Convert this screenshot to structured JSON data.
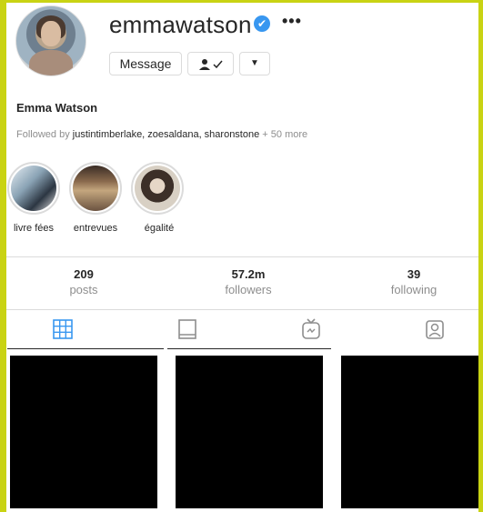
{
  "profile": {
    "username": "emmawatson",
    "verified_icon": "verified-badge-icon",
    "more_icon": "ellipsis-icon",
    "full_name": "Emma Watson",
    "followed_by_prefix": "Followed by",
    "followed_by_names": "justintimberlake, zoesaldana, sharonstone",
    "followed_by_more": "+ 50 more"
  },
  "actions": {
    "message_label": "Message",
    "following_icon": "person-check-icon",
    "dropdown_icon": "caret-down-icon"
  },
  "highlights": [
    {
      "label": "livre fées"
    },
    {
      "label": "entrevues"
    },
    {
      "label": "égalité"
    }
  ],
  "stats": [
    {
      "value": "209",
      "label": "posts"
    },
    {
      "value": "57.2m",
      "label": "followers"
    },
    {
      "value": "39",
      "label": "following"
    }
  ],
  "tabs": [
    {
      "icon": "grid-icon",
      "active": true,
      "color": "#3897f0"
    },
    {
      "icon": "tv-frame-icon",
      "active": false
    },
    {
      "icon": "igtv-icon",
      "active": false
    },
    {
      "icon": "tagged-person-icon",
      "active": false
    }
  ],
  "colors": {
    "accent": "#3897f0",
    "frame": "#c9d313",
    "muted_text": "#8e8e8e",
    "border": "#dbdbdb"
  }
}
